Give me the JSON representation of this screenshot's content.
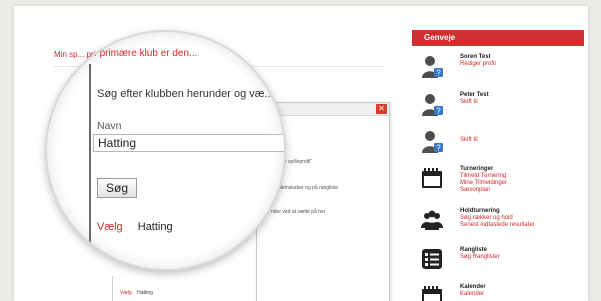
{
  "left": {
    "intro": "Min sp... primære klub er den...",
    "search_instruction": "Søg efter klubben herunder og væ...",
    "name_label": "Navn",
    "name_value": "Hatting",
    "search_button": "Søg",
    "result_choose": "Vælg",
    "result_club": "Hatting"
  },
  "dialog": {
    "close_glyph": "✕",
    "line1": "r \"Mine spilleprofil\"",
    "line2": "medlemskaber og på rangliste",
    "line3": "nder ved at sætte på her"
  },
  "panel": {
    "header": "Genveje",
    "items": [
      {
        "icon": "user-edit-icon",
        "title": "Soren Test",
        "lines": [
          "Rediger profil"
        ]
      },
      {
        "icon": "user-switch-icon",
        "title": "Peter Test",
        "lines": [
          "Skift til"
        ]
      },
      {
        "icon": "user-switch-icon",
        "title": "",
        "lines": [
          "Skift til"
        ]
      },
      {
        "icon": "calendar-icon",
        "title": "Turneringer",
        "lines": [
          "Tilmeld Turnering",
          "Mine Tilmeldinger",
          "Sæsonplan"
        ]
      },
      {
        "icon": "team-icon",
        "title": "Holdturnering",
        "lines": [
          "Søg rækker og hold",
          "Senest indtastede resultater"
        ]
      },
      {
        "icon": "list-icon",
        "title": "Rangliste",
        "lines": [
          "Søg Ranglister"
        ]
      },
      {
        "icon": "calendar-icon",
        "title": "Kalender",
        "lines": [
          "Kalender"
        ]
      }
    ]
  },
  "colors": {
    "accent": "#cf2f2f",
    "text": "#222222"
  }
}
